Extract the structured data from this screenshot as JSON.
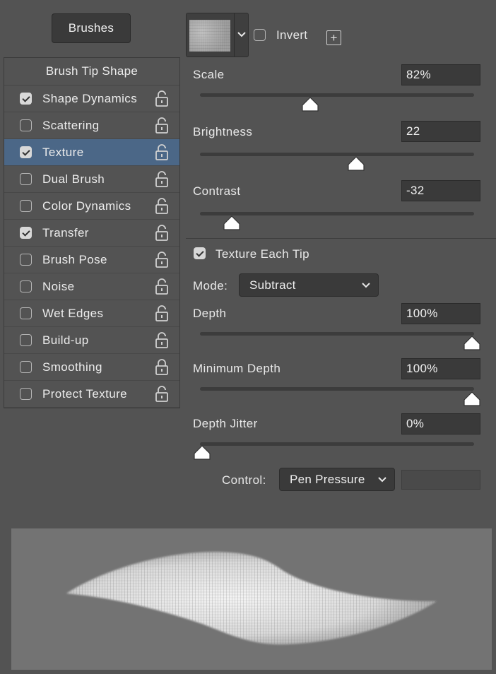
{
  "header": {
    "brushes_label": "Brushes"
  },
  "options": {
    "title": "Brush Tip Shape",
    "items": [
      {
        "label": "Shape Dynamics",
        "checked": true,
        "locked": false,
        "selected": false
      },
      {
        "label": "Scattering",
        "checked": false,
        "locked": false,
        "selected": false
      },
      {
        "label": "Texture",
        "checked": true,
        "locked": false,
        "selected": true
      },
      {
        "label": "Dual Brush",
        "checked": false,
        "locked": false,
        "selected": false
      },
      {
        "label": "Color Dynamics",
        "checked": false,
        "locked": false,
        "selected": false
      },
      {
        "label": "Transfer",
        "checked": true,
        "locked": false,
        "selected": false
      },
      {
        "label": "Brush Pose",
        "checked": false,
        "locked": false,
        "selected": false
      },
      {
        "label": "Noise",
        "checked": false,
        "locked": false,
        "selected": false
      },
      {
        "label": "Wet Edges",
        "checked": false,
        "locked": false,
        "selected": false
      },
      {
        "label": "Build-up",
        "checked": false,
        "locked": false,
        "selected": false
      },
      {
        "label": "Smoothing",
        "checked": false,
        "locked": true,
        "selected": false
      },
      {
        "label": "Protect Texture",
        "checked": false,
        "locked": false,
        "selected": false
      }
    ]
  },
  "texture": {
    "invert_label": "Invert",
    "invert_checked": false,
    "scale": {
      "label": "Scale",
      "value": "82%",
      "level": 0.4
    },
    "brightness": {
      "label": "Brightness",
      "value": "22",
      "level": 0.57
    },
    "contrast": {
      "label": "Contrast",
      "value": "-32",
      "level": 0.11
    },
    "each_tip": {
      "label": "Texture Each Tip",
      "checked": true
    },
    "mode": {
      "label": "Mode:",
      "value": "Subtract"
    },
    "depth": {
      "label": "Depth",
      "value": "100%",
      "level": 1.0
    },
    "min_depth": {
      "label": "Minimum Depth",
      "value": "100%",
      "level": 1.0
    },
    "depth_jitter": {
      "label": "Depth Jitter",
      "value": "0%",
      "level": 0.0
    },
    "control": {
      "label": "Control:",
      "value": "Pen Pressure"
    }
  },
  "colors": {
    "selected_row": "#4b6787",
    "panel_bg": "#535353",
    "field_bg": "#3a3a3a"
  },
  "icons": [
    "lock-open-icon",
    "lock-closed-icon",
    "chevron-down-icon",
    "plus-box-icon",
    "checkmark-icon",
    "slider-thumb-icon"
  ]
}
